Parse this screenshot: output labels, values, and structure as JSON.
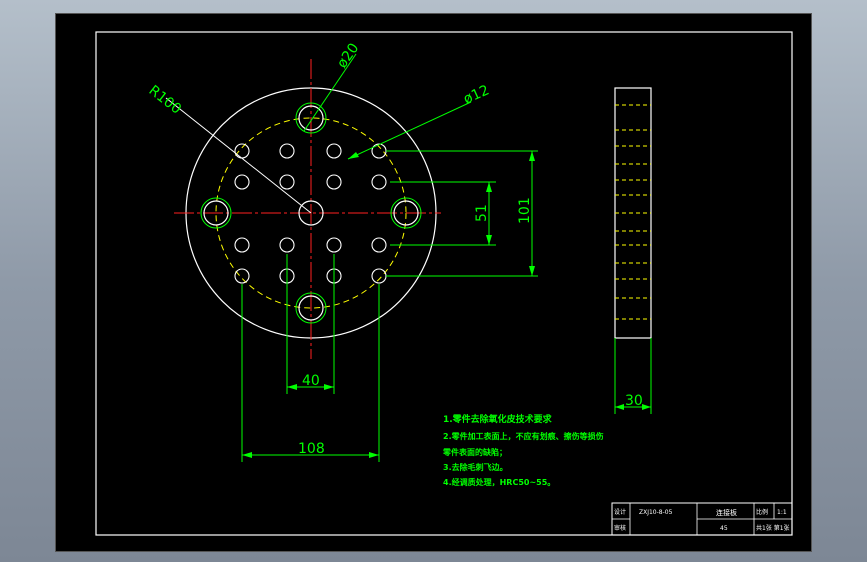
{
  "drawing": {
    "dimensions": {
      "radius": "R100",
      "big_hole_dia": "ø20",
      "small_hole_dia": "ø12",
      "vertical_51": "51",
      "vertical_101": "101",
      "horizontal_40": "40",
      "horizontal_108": "108",
      "thickness": "30"
    },
    "requirements": [
      "1.零件去除氧化皮技术要求",
      "2.零件加工表面上，不应有划痕、擦伤等损伤",
      "零件表面的缺陷；",
      "3.去除毛刺飞边。",
      "4.经调质处理，HRC50~55。"
    ],
    "title_block": {
      "drawing_no": "ZXJ10-8-05",
      "part_name": "连接板",
      "material": "45",
      "scale_label": "比例",
      "scale": "1:1",
      "sheet": "共1张 第1张",
      "label_design": "设计",
      "label_check": "审核"
    }
  }
}
